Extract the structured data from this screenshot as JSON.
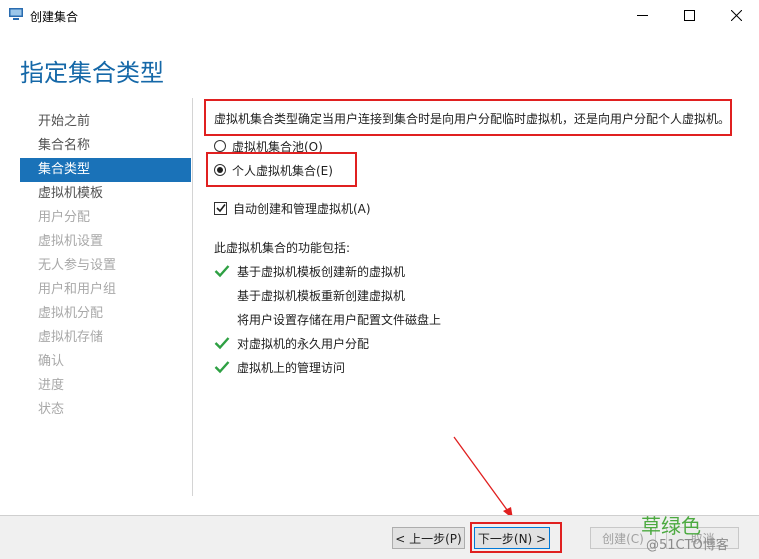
{
  "window": {
    "title": "创建集合",
    "minimize_glyph": "—",
    "maximize_glyph": "☐",
    "close_glyph": "✕"
  },
  "page": {
    "heading": "指定集合类型",
    "description": "虚拟机集合类型确定当用户连接到集合时是向用户分配临时虚拟机，还是向用户分配个人虚拟机。"
  },
  "sidebar": {
    "items": [
      {
        "label": "开始之前",
        "state": "normal"
      },
      {
        "label": "集合名称",
        "state": "normal"
      },
      {
        "label": "集合类型",
        "state": "active"
      },
      {
        "label": "虚拟机模板",
        "state": "normal"
      },
      {
        "label": "用户分配",
        "state": "disabled"
      },
      {
        "label": "虚拟机设置",
        "state": "disabled"
      },
      {
        "label": "无人参与设置",
        "state": "disabled"
      },
      {
        "label": "用户和用户组",
        "state": "disabled"
      },
      {
        "label": "虚拟机分配",
        "state": "disabled"
      },
      {
        "label": "虚拟机存储",
        "state": "disabled"
      },
      {
        "label": "确认",
        "state": "disabled"
      },
      {
        "label": "进度",
        "state": "disabled"
      },
      {
        "label": "状态",
        "state": "disabled"
      }
    ]
  },
  "options": {
    "pooled_label": "虚拟机集合池(O)",
    "pooled_checked": false,
    "personal_label": "个人虚拟机集合(E)",
    "personal_checked": true,
    "auto_create_label": "自动创建和管理虚拟机(A)",
    "auto_create_checked": true
  },
  "features": {
    "label": "此虚拟机集合的功能包括:",
    "items": [
      {
        "text": "基于虚拟机模板创建新的虚拟机",
        "supported": true
      },
      {
        "text": "基于虚拟机模板重新创建虚拟机",
        "supported": false
      },
      {
        "text": "将用户设置存储在用户配置文件磁盘上",
        "supported": false
      },
      {
        "text": "对虚拟机的永久用户分配",
        "supported": true
      },
      {
        "text": "虚拟机上的管理访问",
        "supported": true
      }
    ]
  },
  "footer": {
    "prev_label": "< 上一步(P)",
    "next_label": "下一步(N) >",
    "create_label": "创建(C)",
    "cancel_label": "取消"
  },
  "watermark": {
    "main": "草绿色",
    "sub": "@51CTO博客"
  },
  "colors": {
    "accent": "#1a72b8",
    "heading": "#1568a8",
    "highlight": "#e02020",
    "check": "#2ea043",
    "watermark": "#4caa40"
  }
}
